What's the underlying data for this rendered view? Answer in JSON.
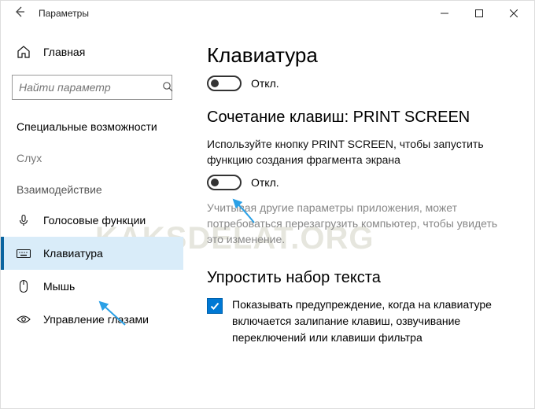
{
  "window": {
    "title": "Параметры"
  },
  "sidebar": {
    "home_label": "Главная",
    "search_placeholder": "Найти параметр",
    "section_main": "Специальные возможности",
    "section_hearing": "Слух",
    "section_interaction": "Взаимодействие",
    "items": {
      "speech": "Голосовые функции",
      "keyboard": "Клавиатура",
      "mouse": "Мышь",
      "eye": "Управление глазами"
    }
  },
  "content": {
    "page_title": "Клавиатура",
    "toggle1_state": "Откл.",
    "section_printscreen_title": "Сочетание клавиш: PRINT SCREEN",
    "printscreen_desc": "Используйте кнопку PRINT SCREEN, чтобы запустить функцию создания фрагмента экрана",
    "toggle2_state": "Откл.",
    "printscreen_note": "Учитывая другие параметры приложения, может потребоваться перезагрузить компьютер, чтобы увидеть это изменение.",
    "simplify_title": "Упростить набор текста",
    "checkbox_text": "Показывать предупреждение, когда на клавиатуре включается залипание клавиш, озвучивание переключений или клавиши фильтра"
  },
  "watermark": "KAKSDELAT.ORG"
}
